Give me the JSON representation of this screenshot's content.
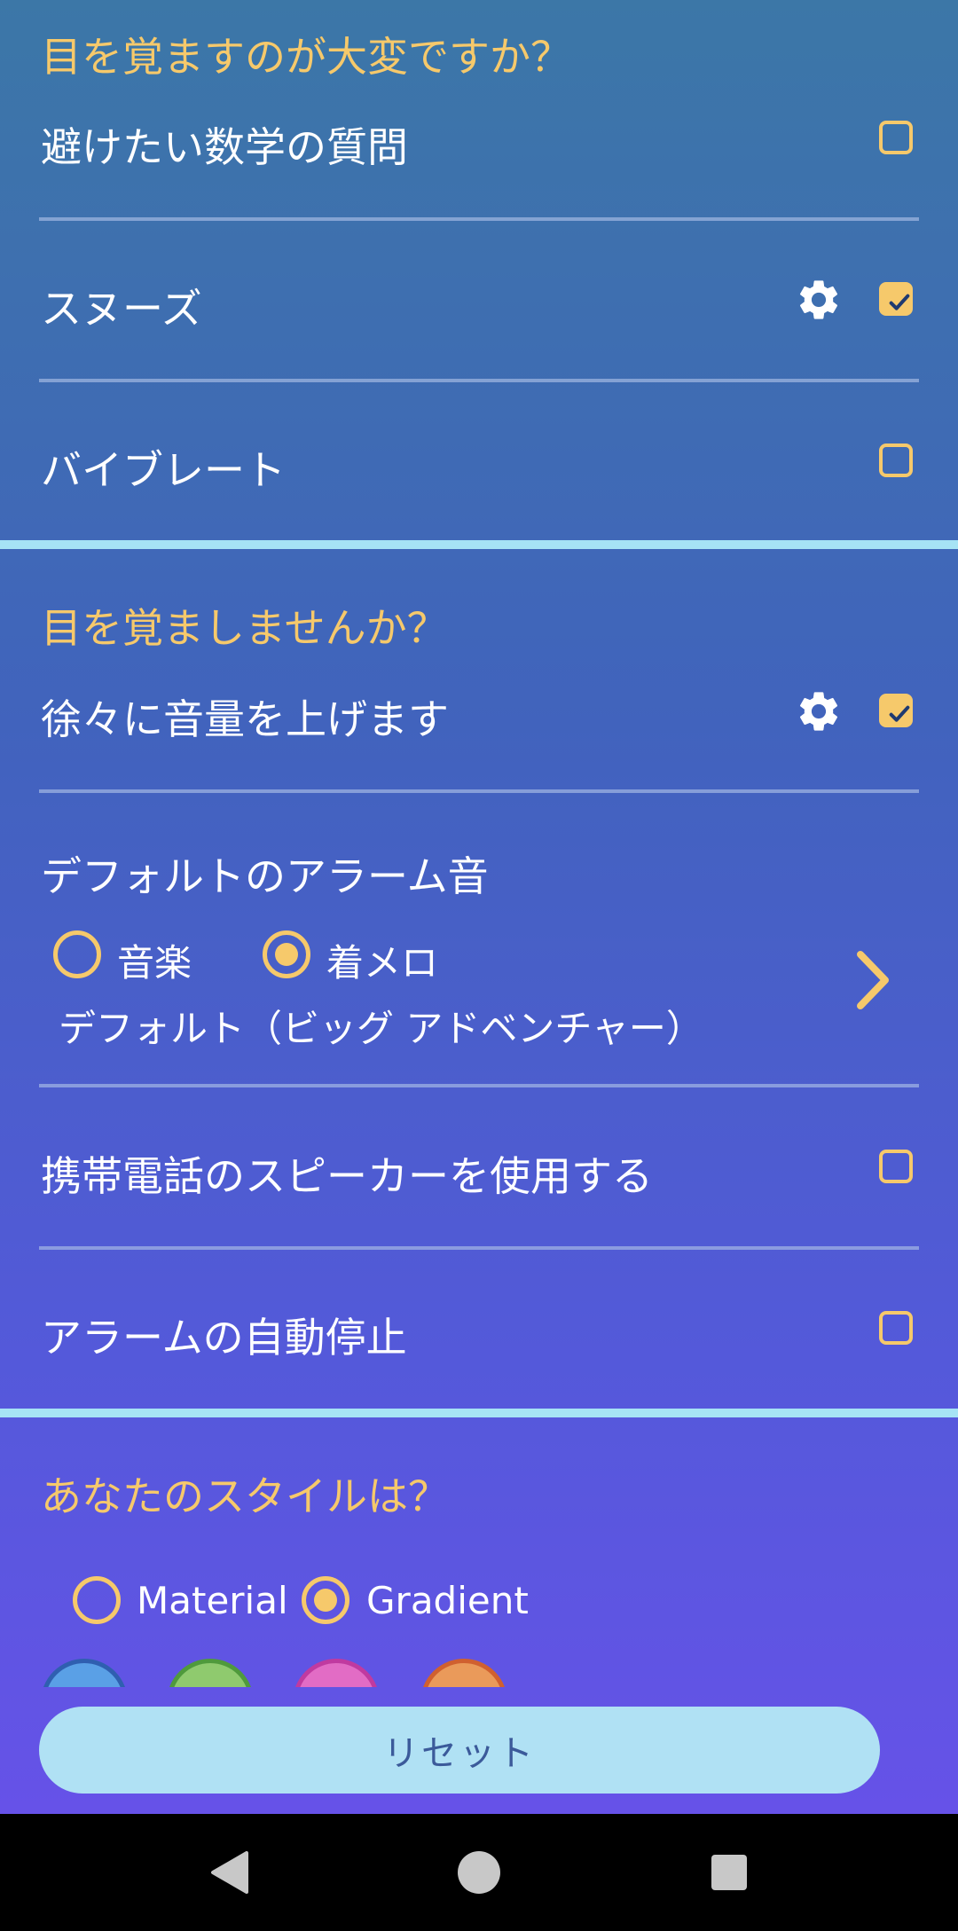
{
  "sections": {
    "hard_to_wake": {
      "title": "目を覚ますのが大変ですか？",
      "rows": [
        {
          "label": "避けたい数学の質問",
          "checked": false
        },
        {
          "label": "スヌーズ",
          "checked": true,
          "has_settings": true
        },
        {
          "label": "バイブレート",
          "checked": false
        }
      ]
    },
    "wake_up": {
      "title": "目を覚ましませんか？",
      "gradual_volume": {
        "label": "徐々に音量を上げます",
        "checked": true,
        "has_settings": true
      },
      "default_alarm": {
        "label": "デフォルトのアラーム音",
        "options": [
          "音楽",
          "着メロ"
        ],
        "selected": "着メロ",
        "current_tone": "デフォルト（ビッグ アドベンチャー）"
      },
      "speaker": {
        "label": "携帯電話のスピーカーを使用する",
        "checked": false
      },
      "auto_stop": {
        "label": "アラームの自動停止",
        "checked": false
      }
    },
    "style": {
      "title": "あなたのスタイルは？",
      "options": [
        "Material",
        "Gradient"
      ],
      "selected": "Gradient",
      "swatches": [
        {
          "name": "blue",
          "color": "#5aa0e6",
          "border": "#2f5fb0"
        },
        {
          "name": "green",
          "color": "#8fca6e",
          "border": "#4f9a3c"
        },
        {
          "name": "pink",
          "color": "#e26cc5",
          "border": "#c03aa0"
        },
        {
          "name": "orange",
          "color": "#ea9a5a",
          "border": "#d0602f"
        }
      ]
    }
  },
  "reset_label": "リセット",
  "colors": {
    "accent": "#f6c96b",
    "separator": "#a6e3f5",
    "button_bg": "#b0e1f4"
  },
  "navbar": {
    "back": "back-icon",
    "home": "home-icon",
    "recents": "recents-icon"
  }
}
